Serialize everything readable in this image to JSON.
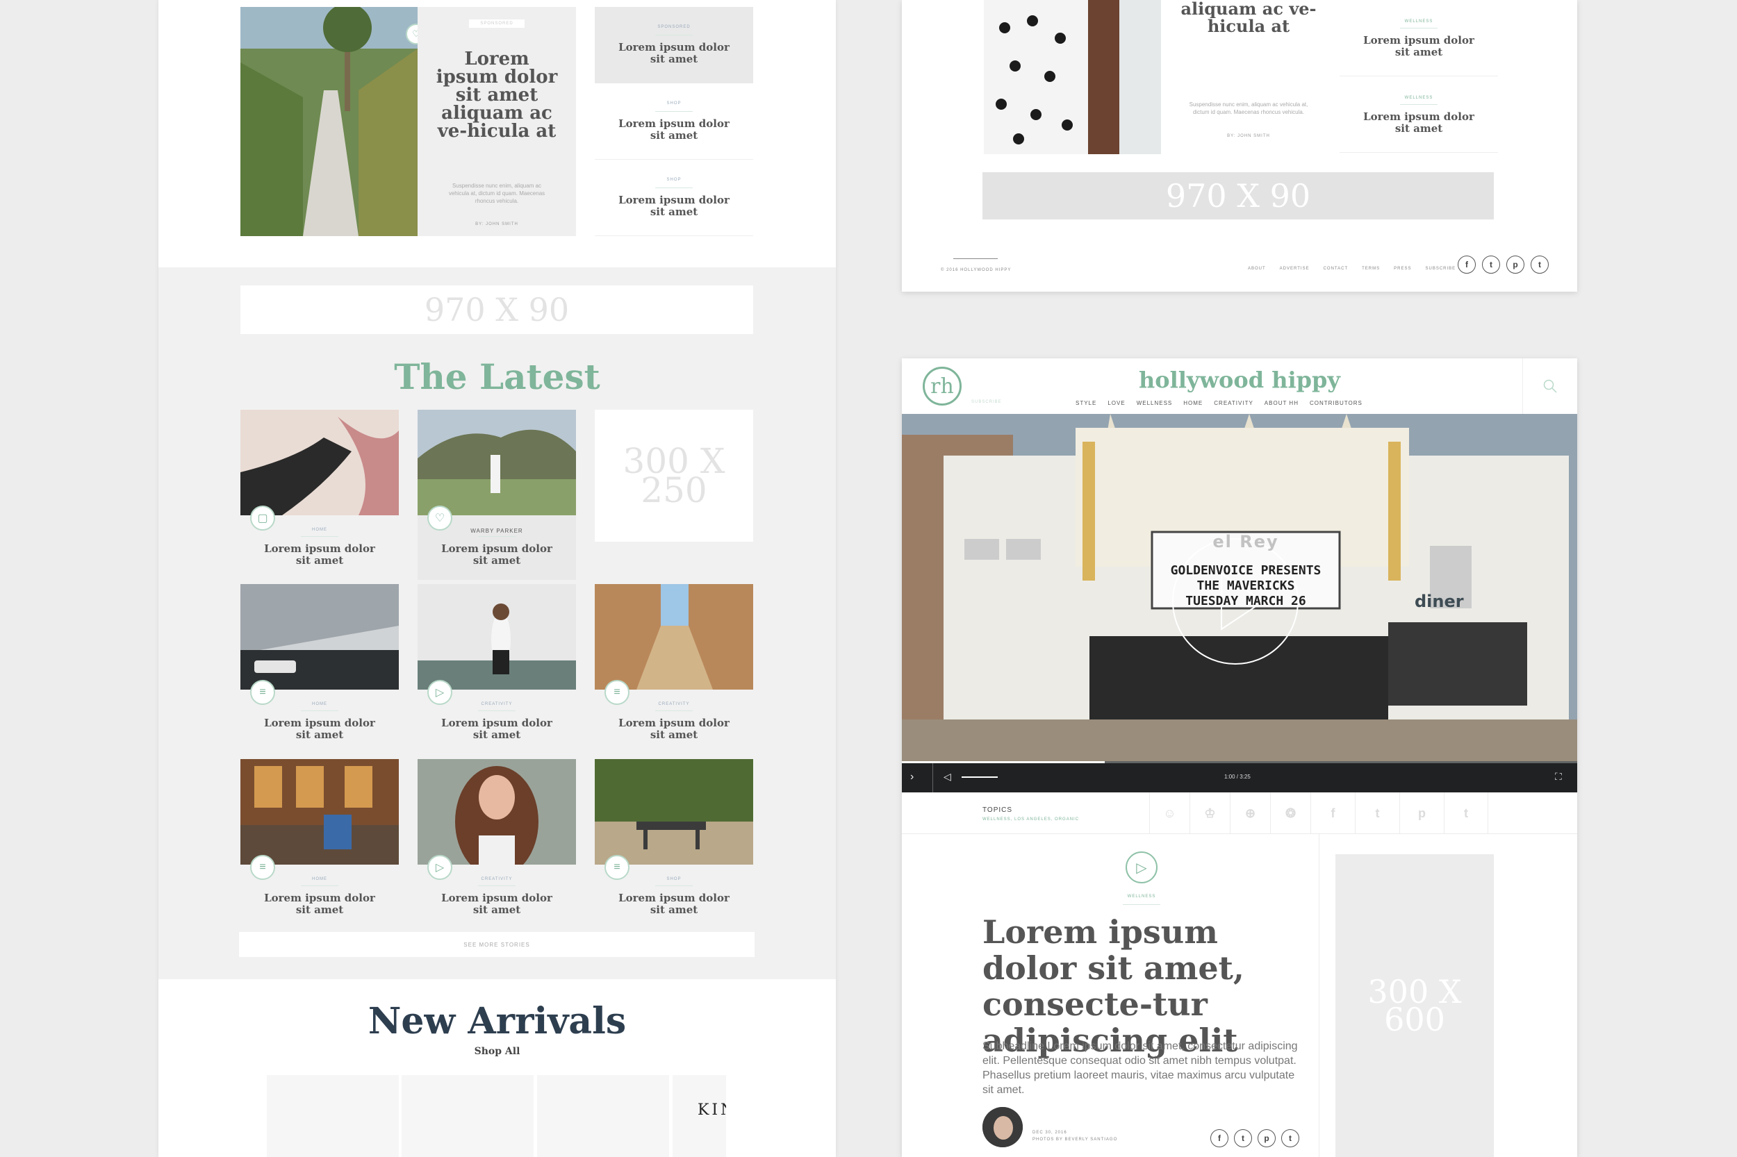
{
  "left": {
    "hero": {
      "badge": "SPONSORED",
      "title": "Lorem ipsum dolor sit amet aliquam ac ve-hicula at",
      "excerpt": "Suspendisse nunc enim, aliquam ac vehicula at, dictum id quam. Maecenas rhoncus vehicula.",
      "byline": "BY: JOHN SMITH"
    },
    "side_list": [
      {
        "cat": "SPONSORED",
        "title": "Lorem ipsum dolor sit amet"
      },
      {
        "cat": "SHOP",
        "title": "Lorem ipsum dolor sit amet"
      },
      {
        "cat": "SHOP",
        "title": "Lorem ipsum dolor sit amet"
      }
    ],
    "ad_banner": "970 X 90",
    "latest_title": "The Latest",
    "ad_square": "300 X 250",
    "grid": [
      {
        "cat": "HOME",
        "title": "Lorem ipsum dolor sit amet",
        "icon": "gallery-icon"
      },
      {
        "cat": "WARBY PARKER",
        "title": "Lorem ipsum dolor sit amet",
        "icon": "heart-icon"
      },
      {
        "cat": "HOME",
        "title": "Lorem ipsum dolor sit amet",
        "icon": "list-icon"
      },
      {
        "cat": "CREATIVITY",
        "title": "Lorem ipsum dolor sit amet",
        "icon": "play-icon"
      },
      {
        "cat": "CREATIVITY",
        "title": "Lorem ipsum dolor sit amet",
        "icon": "list-icon"
      },
      {
        "cat": "HOME",
        "title": "Lorem ipsum dolor sit amet",
        "icon": "list-icon"
      },
      {
        "cat": "CREATIVITY",
        "title": "Lorem ipsum dolor sit amet",
        "icon": "play-icon"
      },
      {
        "cat": "SHOP",
        "title": "Lorem ipsum dolor sit amet",
        "icon": "list-icon"
      }
    ],
    "see_more": "SEE MORE STORIES",
    "new_arrivals": "New Arrivals",
    "shop_all": "Shop All",
    "product_text": "KIN"
  },
  "right_top": {
    "hero_title": "aliquam ac ve-hicula at",
    "hero_excerpt": "Suspendisse nunc enim, aliquam ac vehicula at, dictum id quam. Maecenas rhoncus vehicula.",
    "hero_byline": "BY: JOHN SMITH",
    "side_list": [
      {
        "cat": "WELLNESS",
        "title": "Lorem ipsum dolor sit amet"
      },
      {
        "cat": "WELLNESS",
        "title": "Lorem ipsum dolor sit amet"
      }
    ],
    "ad_banner": "970 X 90",
    "copyright": "© 2016 HOLLYWOOD HIPPY",
    "footer_links": [
      "ABOUT",
      "ADVERTISE",
      "CONTACT",
      "TERMS",
      "PRESS",
      "SUBSCRIBE"
    ],
    "social": [
      "f",
      "t",
      "p",
      "t"
    ]
  },
  "right_bottom": {
    "brand": "hollywood hippy",
    "subscribe": "SUBSCRIBE",
    "nav": [
      "STYLE",
      "LOVE",
      "WELLNESS",
      "HOME",
      "CREATIVITY",
      "ABOUT HH",
      "CONTRIBUTORS"
    ],
    "marquee_lines": [
      "GOLDENVOICE PRESENTS",
      "THE MAVERICKS",
      "TUESDAY MARCH 26"
    ],
    "sign_rey": "el Rey",
    "sign_diner": "diner",
    "video_time": "1:00 / 3:25",
    "video_progress": 0.3,
    "topics_label": "TOPICS",
    "topics_value": "WELLNESS, LOS ANGELES, ORGANIC",
    "share": [
      "f",
      "t",
      "p",
      "t"
    ],
    "article_cat": "WELLNESS",
    "article_title": "Lorem ipsum dolor sit amet, consecte-tur adipiscing elit",
    "article_sub": "Subheadline Lorem ipsum dolor sit amet, consectetur adipiscing elit. Pellentesque consequat odio sit amet nibh tempus volutpat. Phasellus pretium laoreet mauris, vitae maximus arcu vulputate sit amet.",
    "article_date": "DEC 30, 2016",
    "article_photos": "PHOTOS BY BEVERLY SANTIAGO",
    "ad_tall": "300 X 600",
    "social": [
      "f",
      "t",
      "p",
      "t"
    ]
  },
  "colors": {
    "accent": "#7fb59a",
    "dark": "#2d3e4f",
    "ad": "#e3e3e3"
  }
}
